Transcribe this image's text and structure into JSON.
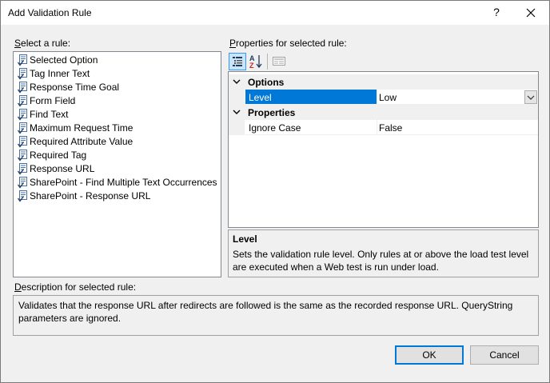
{
  "window": {
    "title": "Add Validation Rule",
    "help_glyph": "?"
  },
  "rules": {
    "label": "Select a rule:",
    "selected_index": 8,
    "items": [
      {
        "label": "Selected Option"
      },
      {
        "label": "Tag Inner Text"
      },
      {
        "label": "Response Time Goal"
      },
      {
        "label": "Form Field"
      },
      {
        "label": "Find Text"
      },
      {
        "label": "Maximum Request Time"
      },
      {
        "label": "Required Attribute Value"
      },
      {
        "label": "Required Tag"
      },
      {
        "label": "Response URL"
      },
      {
        "label": "SharePoint - Find Multiple Text Occurrences"
      },
      {
        "label": "SharePoint - Response URL"
      }
    ]
  },
  "properties": {
    "label": "Properties for selected rule:",
    "toolbar": {
      "categorized_icon": "categorized-icon",
      "alphabetical_icon": "sort-az-icon",
      "property_pages_icon": "property-pages-icon"
    },
    "categories": [
      {
        "name": "Options",
        "rows": [
          {
            "name": "Level",
            "value": "Low"
          }
        ]
      },
      {
        "name": "Properties",
        "rows": [
          {
            "name": "Ignore Case",
            "value": "False"
          }
        ]
      }
    ]
  },
  "help": {
    "title": "Level",
    "description": "Sets the validation rule level.  Only rules at or above the load test level are executed when a Web test is run under load."
  },
  "description": {
    "label": "Description for selected rule:",
    "text": "Validates that the response URL after redirects are followed is the same as the recorded response URL.  QueryString parameters are ignored."
  },
  "buttons": {
    "ok": "OK",
    "cancel": "Cancel"
  },
  "colors": {
    "selection": "#0078d7",
    "accent": "#3399ff"
  }
}
